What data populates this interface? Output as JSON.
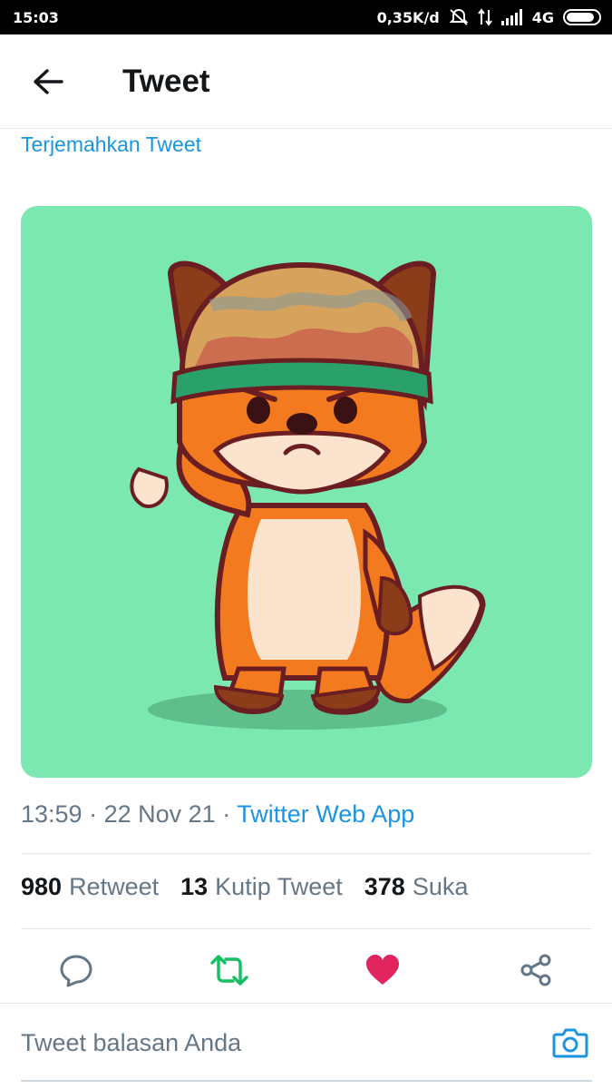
{
  "status_bar": {
    "time": "15:03",
    "speed": "0,35K/d",
    "network": "4G",
    "icons": [
      "mute-bell-icon",
      "data-arrows-icon",
      "signal-icon",
      "battery-icon"
    ]
  },
  "header": {
    "title": "Tweet",
    "back_icon": "arrow-left-icon"
  },
  "tweet": {
    "translate_label": "Terjemahkan Tweet",
    "image_description_icon": "fox-soldier-illustration",
    "time": "13:59",
    "date": "22 Nov 21",
    "separator": "·",
    "source": "Twitter Web App",
    "stats": [
      {
        "count": "980",
        "label": "Retweet"
      },
      {
        "count": "13",
        "label": "Kutip Tweet"
      },
      {
        "count": "378",
        "label": "Suka"
      }
    ]
  },
  "actions": {
    "reply_icon": "reply-icon",
    "retweet_icon": "retweet-icon",
    "like_icon": "heart-icon",
    "share_icon": "share-icon"
  },
  "reply_box": {
    "placeholder": "Tweet balasan Anda",
    "camera_icon": "camera-icon"
  },
  "colors": {
    "accent": "#1b95e0",
    "retweet_active": "#17bf63",
    "like_active": "#e0245e",
    "secondary_text": "#657786",
    "media_bg": "#7be7b1"
  }
}
